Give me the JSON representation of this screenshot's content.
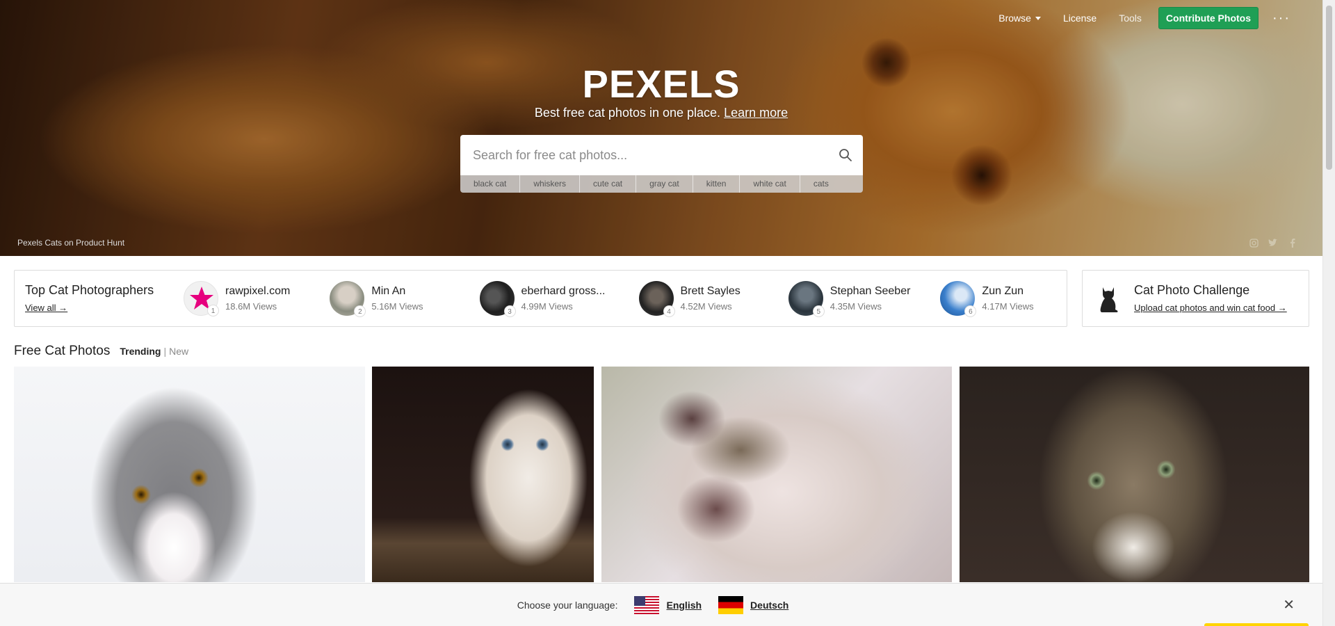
{
  "nav": {
    "browse": "Browse",
    "license": "License",
    "tools": "Tools",
    "contribute": "Contribute Photos",
    "more": "···"
  },
  "hero": {
    "logo": "PEXELS",
    "tagline": "Best free cat photos in one place.",
    "learn_more": "Learn more",
    "search_placeholder": "Search for free cat photos...",
    "tags": [
      "black cat",
      "whiskers",
      "cute cat",
      "gray cat",
      "kitten",
      "white cat",
      "cats"
    ],
    "credit": "Pexels Cats on Product Hunt",
    "social_icons": [
      "instagram-icon",
      "twitter-icon",
      "facebook-icon"
    ]
  },
  "top": {
    "title": "Top Cat Photographers",
    "view_all": "View all →",
    "photographers": [
      {
        "name": "rawpixel.com",
        "views": "18.6M Views",
        "rank": "1"
      },
      {
        "name": "Min An",
        "views": "5.16M Views",
        "rank": "2"
      },
      {
        "name": "eberhard gross...",
        "views": "4.99M Views",
        "rank": "3"
      },
      {
        "name": "Brett Sayles",
        "views": "4.52M Views",
        "rank": "4"
      },
      {
        "name": "Stephan Seeber",
        "views": "4.35M Views",
        "rank": "5"
      },
      {
        "name": "Zun Zun",
        "views": "4.17M Views",
        "rank": "6"
      }
    ]
  },
  "challenge": {
    "title": "Cat Photo Challenge",
    "link": "Upload cat photos and win cat food →"
  },
  "section": {
    "title": "Free Cat Photos",
    "trending": "Trending",
    "separator": "|",
    "new": "New"
  },
  "lang_bar": {
    "label": "Choose your language:",
    "english": "English",
    "deutsch": "Deutsch",
    "close": "✕"
  },
  "colors": {
    "accent_green": "#1f9f55",
    "rank1_star": "#e6007e"
  }
}
